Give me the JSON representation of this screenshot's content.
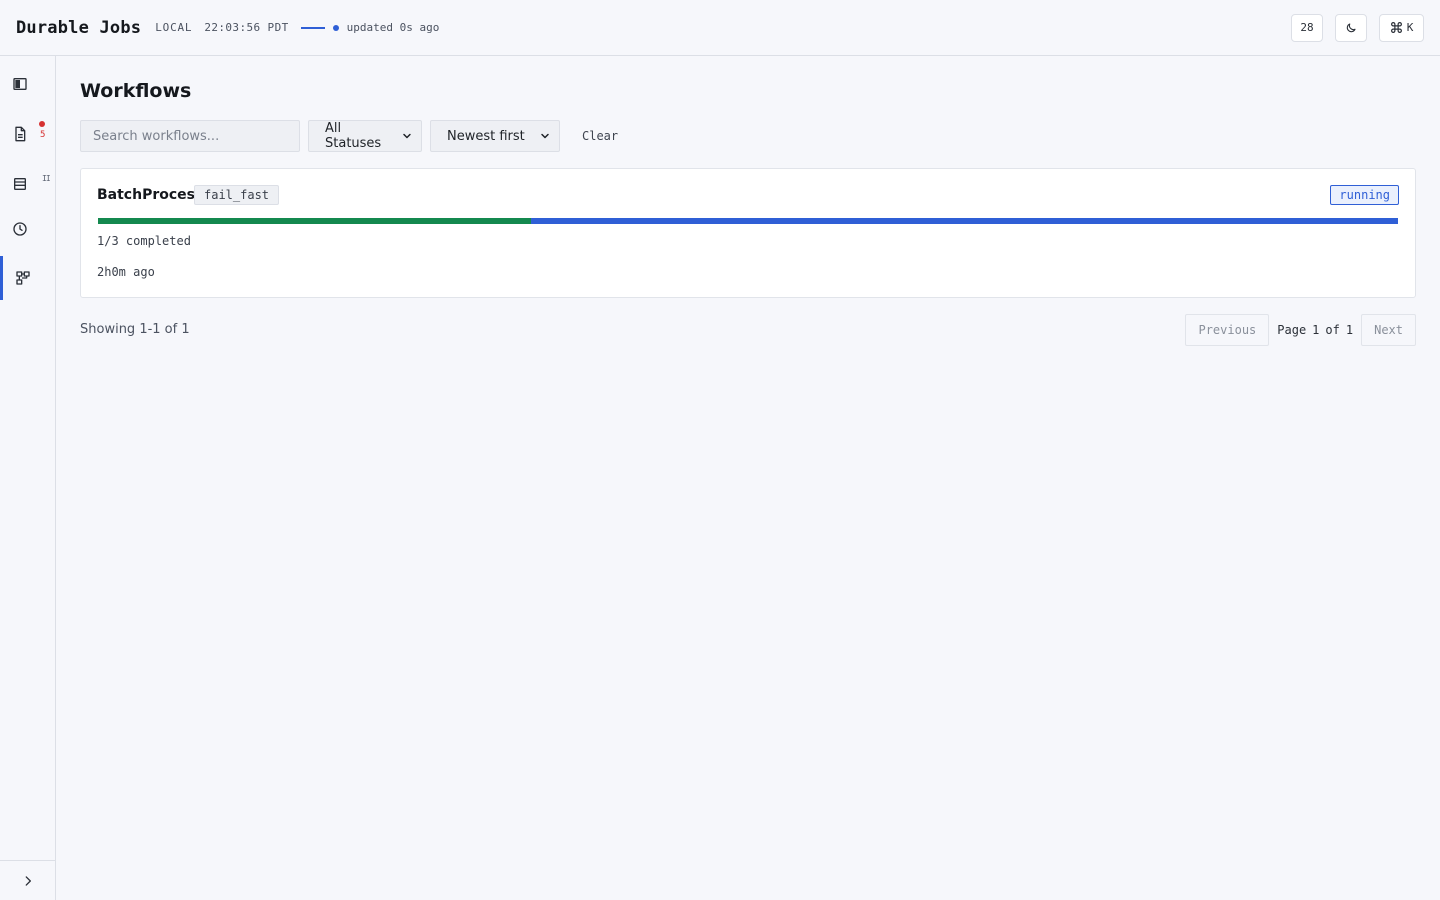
{
  "header": {
    "title": "Durable Jobs",
    "env": "LOCAL",
    "clock": "22:03:56 PDT",
    "updated": "updated 0s ago",
    "count": "28",
    "shortcut_key": "K",
    "accent": "#2f5fd6"
  },
  "sidebar": {
    "items": [
      {
        "icon": "dashboard-icon"
      },
      {
        "icon": "document-icon",
        "badge": "5"
      },
      {
        "icon": "list-icon",
        "badge": "II"
      },
      {
        "icon": "clock-icon"
      },
      {
        "icon": "workflow-icon",
        "active": true
      }
    ]
  },
  "main": {
    "title": "Workflows",
    "search_placeholder": "Search workflows...",
    "status_filter": "All Statuses",
    "sort": "Newest first",
    "clear": "Clear"
  },
  "workflows": [
    {
      "name": "BatchProcess",
      "tag": "fail_fast",
      "status": "running",
      "progress_fraction": 0.3333,
      "progress_text": "1/3 completed",
      "time": "2h0m ago"
    }
  ],
  "pagination": {
    "showing": "Showing 1-1 of 1",
    "previous": "Previous",
    "next": "Next",
    "page_word": "Page",
    "page": "1",
    "of_word": "of",
    "total": "1"
  },
  "colors": {
    "progress_done": "#14894f",
    "progress_remaining": "#2f5fd6",
    "badge_red": "#d63232"
  }
}
